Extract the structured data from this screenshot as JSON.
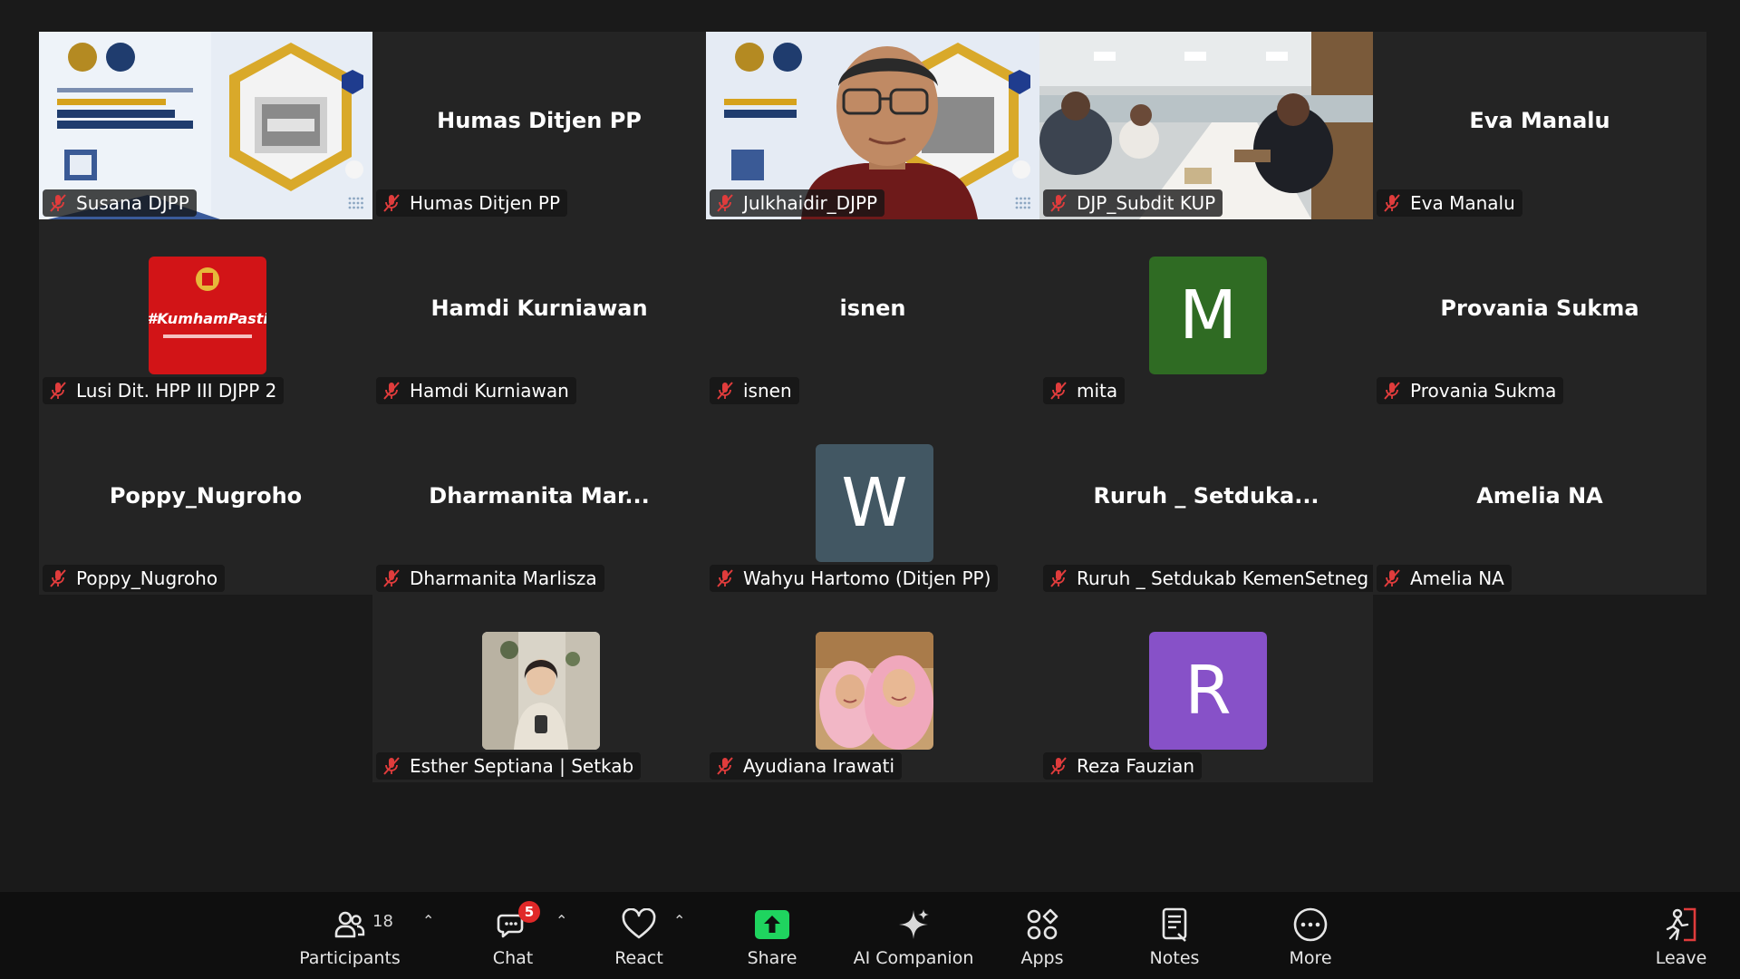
{
  "tiles": [
    {
      "label": "Susana DJPP",
      "kind": "slide"
    },
    {
      "label": "Humas Ditjen PP",
      "center": "Humas Ditjen PP"
    },
    {
      "label": "Julkhaidir_DJPP",
      "kind": "speaker",
      "active": true
    },
    {
      "label": "DJP_Subdit KUP",
      "kind": "room"
    },
    {
      "label": "Eva Manalu",
      "center": "Eva Manalu"
    },
    {
      "label": "Lusi Dit. HPP III DJPP 2",
      "kind": "kumham",
      "image_text": "#KumhamPasti"
    },
    {
      "label": "Hamdi Kurniawan",
      "center": "Hamdi Kurniawan"
    },
    {
      "label": "isnen",
      "center": "isnen"
    },
    {
      "label": "mita",
      "avatar": "M",
      "avatar_color": "#2f6b23"
    },
    {
      "label": "Provania Sukma",
      "center": "Provania Sukma"
    },
    {
      "label": "Poppy_Nugroho",
      "center": "Poppy_Nugroho"
    },
    {
      "label": "Dharmanita Marlisza",
      "center": "Dharmanita  Mar..."
    },
    {
      "label": "Wahyu Hartomo (Ditjen PP)",
      "avatar": "W",
      "avatar_color": "#425763"
    },
    {
      "label": "Ruruh _ Setdukab KemenSetneg",
      "center": "Ruruh  _  Setduka..."
    },
    {
      "label": "Amelia NA",
      "center": "Amelia NA"
    },
    {
      "label": "Esther Septiana | Setkab",
      "kind": "photo-woman"
    },
    {
      "label": "Ayudiana Irawati",
      "kind": "photo-hijab"
    },
    {
      "label": "Reza Fauzian",
      "avatar": "R",
      "avatar_color": "#8751c8"
    }
  ],
  "toolbar": {
    "participants": {
      "label": "Participants",
      "count": "18"
    },
    "chat": {
      "label": "Chat",
      "badge": "5"
    },
    "react": {
      "label": "React"
    },
    "share": {
      "label": "Share"
    },
    "ai": {
      "label": "AI Companion"
    },
    "apps": {
      "label": "Apps"
    },
    "notes": {
      "label": "Notes"
    },
    "more": {
      "label": "More"
    },
    "leave": {
      "label": "Leave"
    }
  },
  "colors": {
    "active_border": "#2de07d",
    "share_green": "#1fd45f",
    "muted_red": "#e03c3c",
    "badge_red": "#e02828"
  }
}
